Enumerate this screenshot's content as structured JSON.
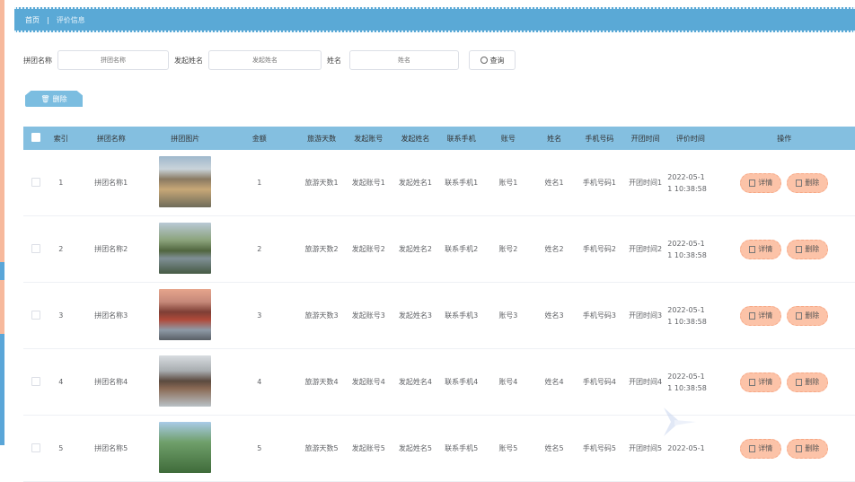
{
  "breadcrumb": {
    "home": "首页",
    "separator": "|",
    "current": "评价信息"
  },
  "search": {
    "fields": [
      {
        "label": "拼团名称",
        "placeholder": "拼团名称"
      },
      {
        "label": "发起姓名",
        "placeholder": "发起姓名"
      },
      {
        "label": "姓名",
        "placeholder": "姓名"
      }
    ],
    "query_label": "查询"
  },
  "toolbar": {
    "delete_label": "删除"
  },
  "table": {
    "headers": [
      "索引",
      "拼团名称",
      "拼团图片",
      "金额",
      "旅游天数",
      "发起账号",
      "发起姓名",
      "联系手机",
      "账号",
      "姓名",
      "手机号码",
      "开团时间",
      "评价时间",
      "操作"
    ],
    "rows": [
      {
        "idx": "1",
        "name": "拼团名称1",
        "amount": "1",
        "days": "旅游天数1",
        "acc": "发起账号1",
        "iname": "发起姓名1",
        "phone": "联系手机1",
        "uacc": "账号1",
        "uname": "姓名1",
        "uphone": "手机号码1",
        "open": "开团时间1",
        "time1": "2022-05-1",
        "time2": "1 10:38:58",
        "img": "cliff"
      },
      {
        "idx": "2",
        "name": "拼团名称2",
        "amount": "2",
        "days": "旅游天数2",
        "acc": "发起账号2",
        "iname": "发起姓名2",
        "phone": "联系手机2",
        "uacc": "账号2",
        "uname": "姓名2",
        "uphone": "手机号码2",
        "open": "开团时间2",
        "time1": "2022-05-1",
        "time2": "1 10:38:58",
        "img": "lake"
      },
      {
        "idx": "3",
        "name": "拼团名称3",
        "amount": "3",
        "days": "旅游天数3",
        "acc": "发起账号3",
        "iname": "发起姓名3",
        "phone": "联系手机3",
        "uacc": "账号3",
        "uname": "姓名3",
        "uphone": "手机号码3",
        "open": "开团时间3",
        "time1": "2022-05-1",
        "time2": "1 10:38:58",
        "img": "gate"
      },
      {
        "idx": "4",
        "name": "拼团名称4",
        "amount": "4",
        "days": "旅游天数4",
        "acc": "发起账号4",
        "iname": "发起姓名4",
        "phone": "联系手机4",
        "uacc": "账号4",
        "uname": "姓名4",
        "uphone": "手机号码4",
        "open": "开团时间4",
        "time1": "2022-05-1",
        "time2": "1 10:38:58",
        "img": "tower"
      },
      {
        "idx": "5",
        "name": "拼团名称5",
        "amount": "5",
        "days": "旅游天数5",
        "acc": "发起账号5",
        "iname": "发起姓名5",
        "phone": "联系手机5",
        "uacc": "账号5",
        "uname": "姓名5",
        "uphone": "手机号码5",
        "open": "开团时间5",
        "time1": "2022-05-1",
        "time2": "",
        "img": "peak"
      }
    ],
    "ops": {
      "detail": "详情",
      "delete": "删除"
    }
  },
  "colors": {
    "header_bar": "#5aa9d6",
    "table_head": "#84bfe0",
    "op_button": "#fcc3a8",
    "delete_button": "#7bbde0"
  }
}
